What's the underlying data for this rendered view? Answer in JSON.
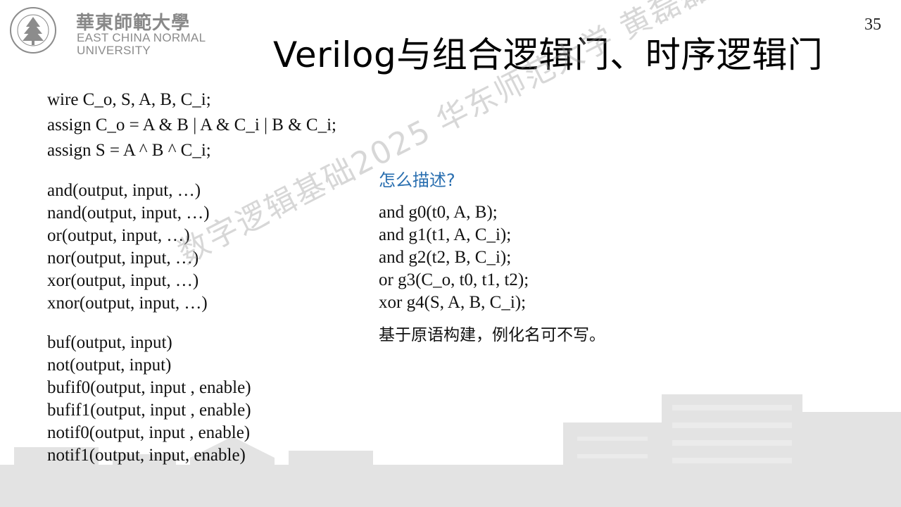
{
  "header": {
    "logo_cn": "華東師範大學",
    "logo_en_line1": "EAST CHINA NORMAL",
    "logo_en_line2": "UNIVERSITY",
    "page_number": "35"
  },
  "title": "Verilog与组合逻辑门、时序逻辑门",
  "left": {
    "assign_block": [
      "wire C_o, S, A, B, C_i;",
      "assign C_o = A & B | A & C_i | B & C_i;",
      "assign S = A ^ B ^ C_i;"
    ],
    "gate_block": [
      "and(output, input, …)",
      "nand(output, input, …)",
      "or(output, input, …)",
      "nor(output, input, …)",
      "xor(output, input, …)",
      "xnor(output, input, …)"
    ],
    "buffer_block": [
      "buf(output, input)",
      "not(output, input)",
      "bufif0(output, input , enable)",
      "bufif1(output, input , enable)",
      "notif0(output, input , enable)",
      "notif1(output, input, enable)"
    ]
  },
  "right": {
    "question": "怎么描述?",
    "code": [
      "and g0(t0, A, B);",
      "and g1(t1, A, C_i);",
      "and g2(t2, B, C_i);",
      "or g3(C_o, t0, t1, t2);",
      "xor g4(S, A, B, C_i);"
    ],
    "note": "基于原语构建，例化名可不写。"
  },
  "watermark": "数字逻辑基础2025 华东师范大学 黄磊磊",
  "colors": {
    "question": "#2a6fb0",
    "watermark": "#969696",
    "logo": "#8c8c8c",
    "skyline": "#d6d6d6"
  }
}
